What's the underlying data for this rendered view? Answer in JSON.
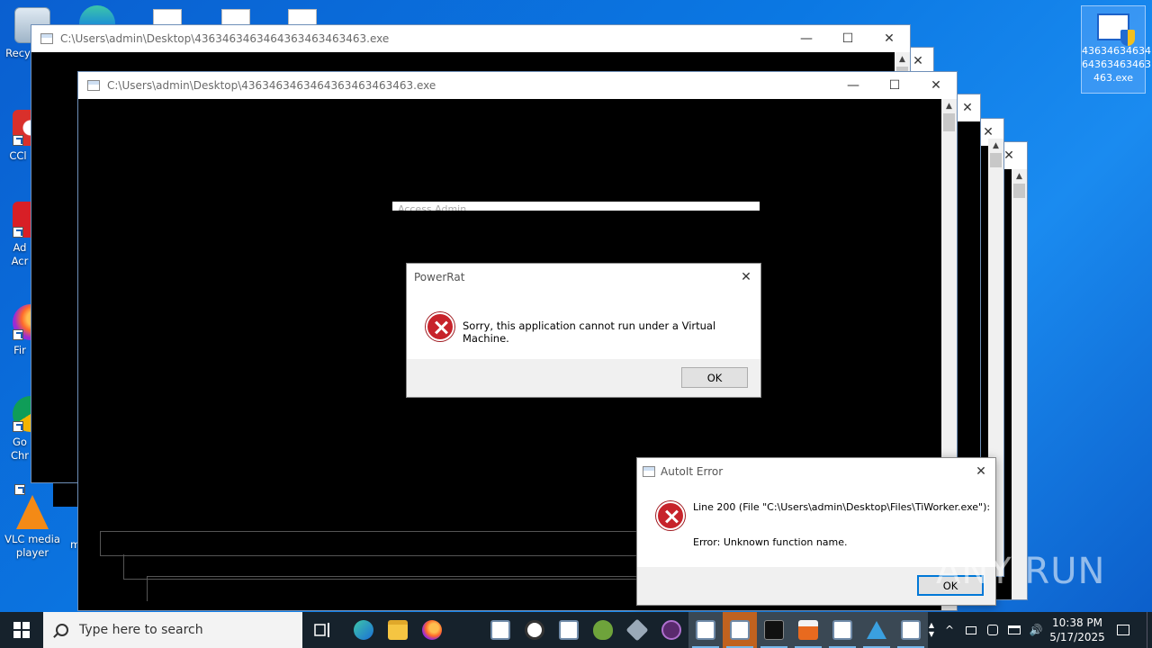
{
  "desktop": {
    "icons": [
      {
        "label": "Recy",
        "name": "recycle-bin"
      },
      {
        "label": "CCl",
        "name": "ccleaner"
      },
      {
        "label": "Ad Acr",
        "name": "adobe-acrobat"
      },
      {
        "label": "Fir",
        "name": "firefox"
      },
      {
        "label": "Go Chr",
        "name": "google-chrome"
      },
      {
        "label": "VLC media player",
        "name": "vlc-media-player"
      },
      {
        "label": "m",
        "name": "partial-icon"
      }
    ],
    "right_icon_label": "43634634634643634634634 63463.exe",
    "right_icon_lines": [
      "43634634634",
      "64363463463",
      "463.exe"
    ]
  },
  "consoles": {
    "win1_title": "C:\\Users\\admin\\Desktop\\436346346346436346346346 3463.exe",
    "win1_title_text": "C:\\Users\\admin\\Desktop\\4363463463464363463463463.exe",
    "win2_title_text": "C:\\Users\\admin\\Desktop\\4363463463464363463463463.exe",
    "minimize": "—",
    "maximize": "☐",
    "close": "✕",
    "hidden_title": "Access Admin"
  },
  "powerrat": {
    "title": "PowerRat",
    "message": "Sorry, this application cannot run under a Virtual Machine.",
    "ok": "OK"
  },
  "autoit": {
    "title": "AutoIt Error",
    "line1": "Line 200  (File \"C:\\Users\\admin\\Desktop\\Files\\TiWorker.exe\"):",
    "line2": "Error: Unknown function name.",
    "ok": "OK"
  },
  "taskbar": {
    "search_placeholder": "Type here to search",
    "time": "10:38 PM",
    "date": "5/17/2025"
  },
  "watermark": "ANY RUN",
  "colors": {
    "desktop": "#0b78e3",
    "taskbar": "#16222c",
    "error_red": "#c7232b",
    "focus_blue": "#0078d7"
  }
}
